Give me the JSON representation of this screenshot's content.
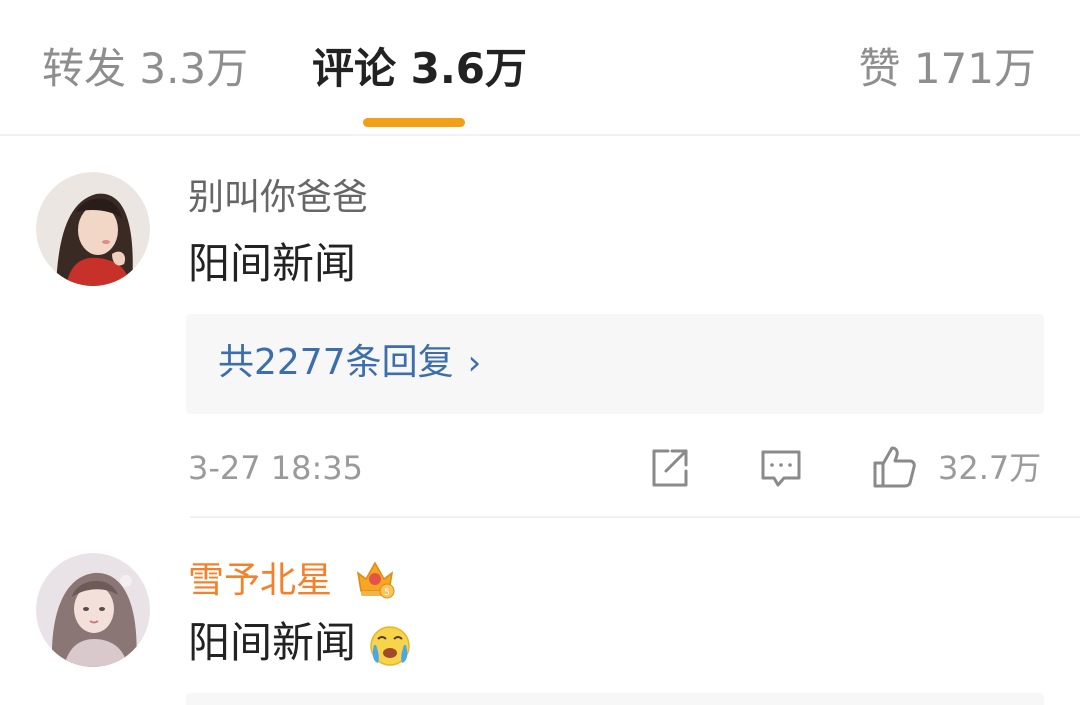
{
  "tabs": {
    "repost": "转发 3.3万",
    "comments": "评论 3.6万",
    "likes": "赞 171万",
    "active": "comments"
  },
  "comments": [
    {
      "username": "别叫你爸爸",
      "content": "阳间新闻",
      "replies_link": "共2277条回复",
      "time": "3-27 18:35",
      "like_count": "32.7万",
      "avatar_icon": "avatar-girl-dark-hair"
    },
    {
      "username": "雪予北星",
      "content": "阳间新闻",
      "badge_icon": "vip-crown-icon",
      "emoji_icon": "crying-face-emoji-icon",
      "avatar_icon": "avatar-girl-light-hair"
    }
  ],
  "colors": {
    "accent": "#f09f17",
    "link": "#3b6eaa",
    "vip_name": "#f5802a",
    "muted": "#9a9a9a"
  }
}
